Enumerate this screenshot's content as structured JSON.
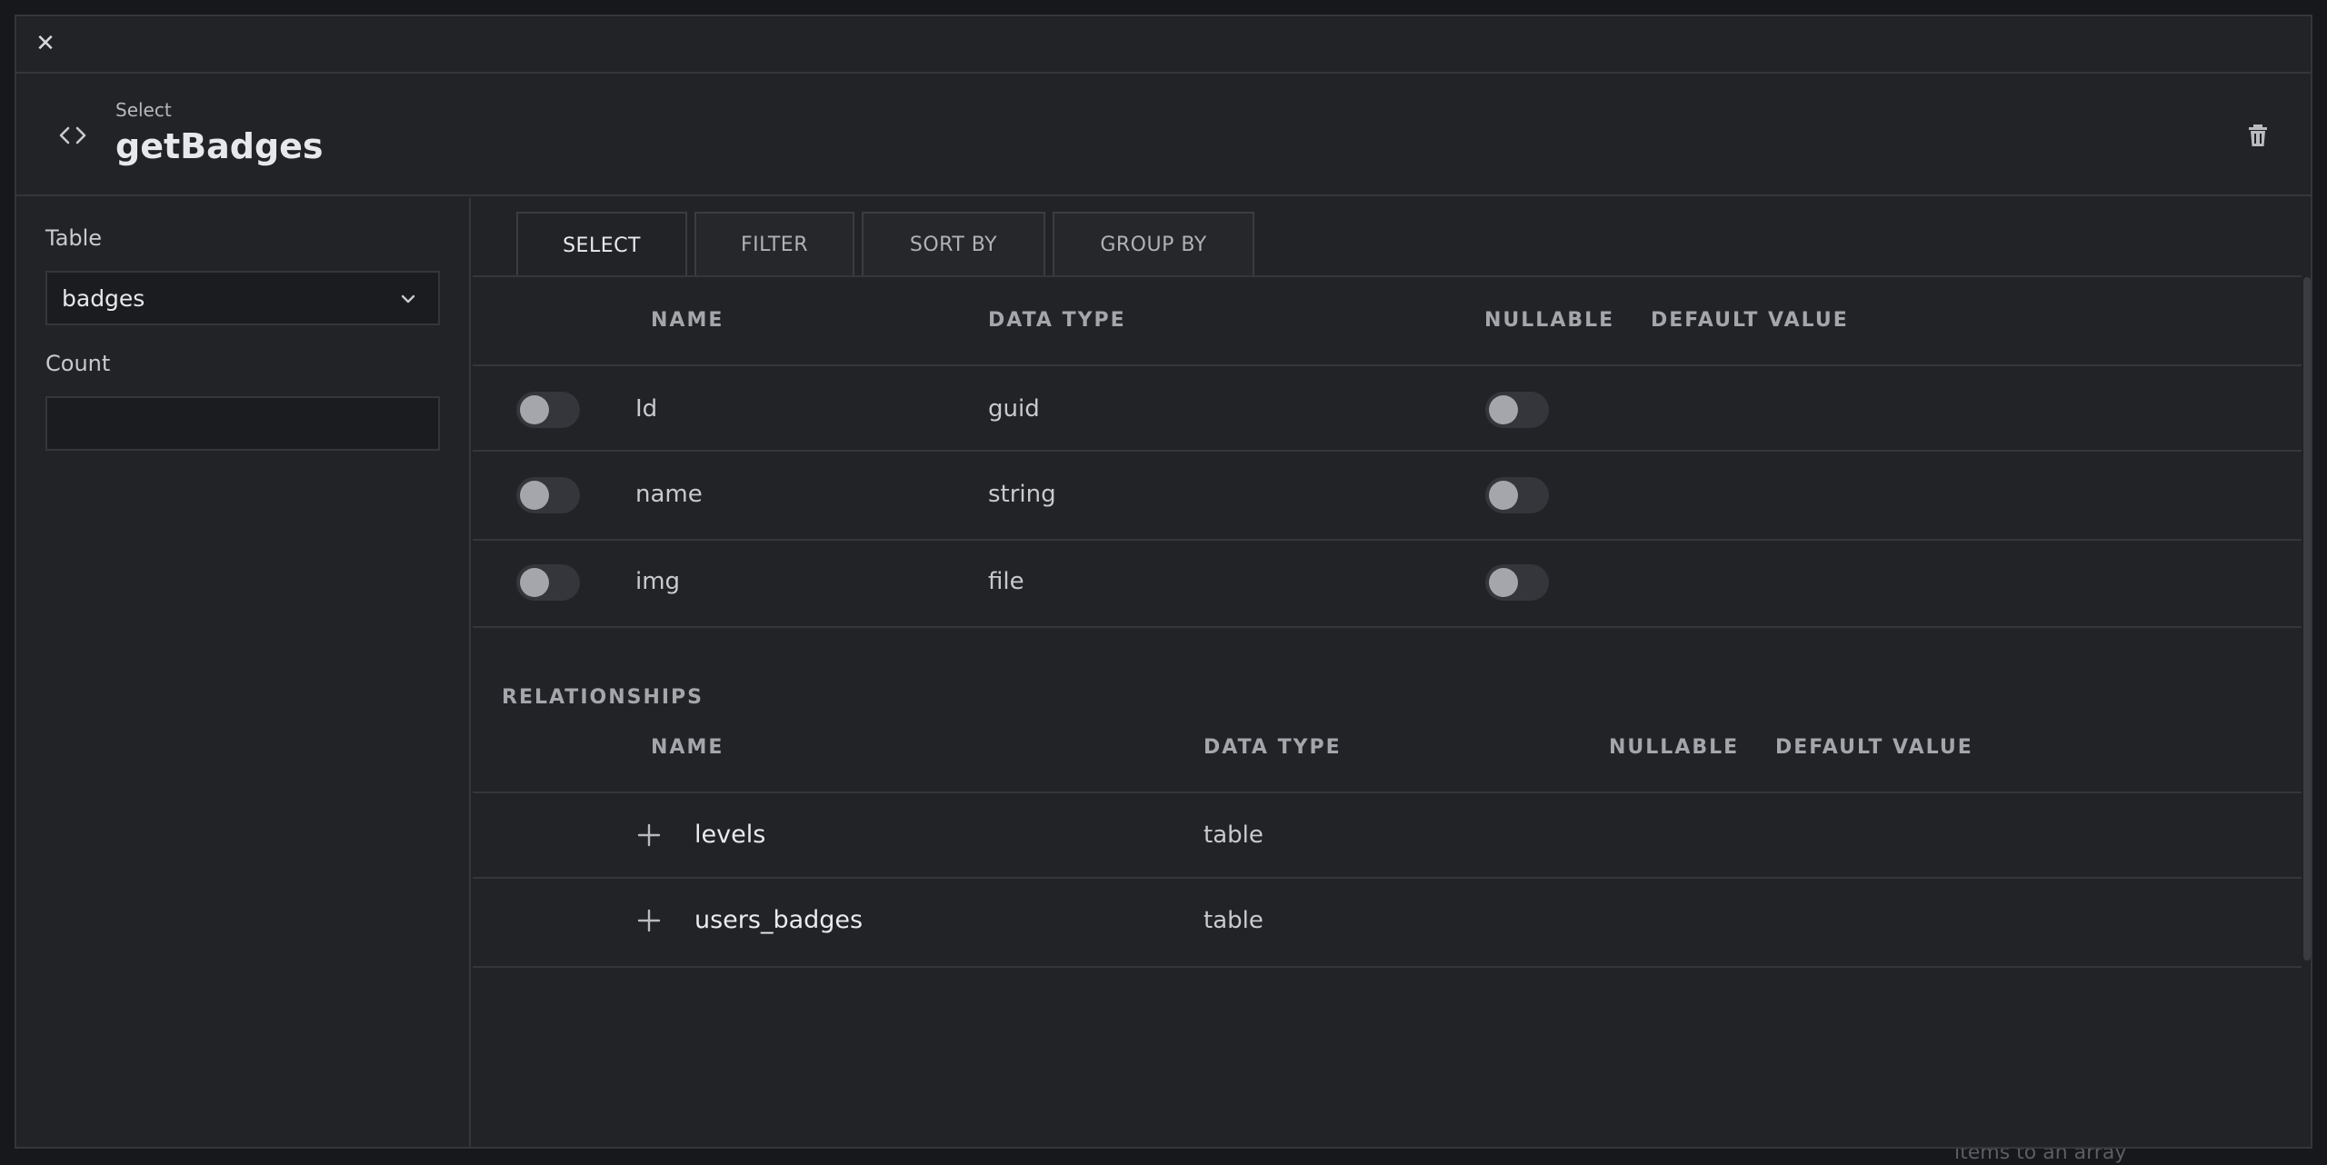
{
  "modal": {
    "close_glyph": "✕",
    "header": {
      "icon": "code-icon",
      "subtitle": "Select",
      "title": "getBadges",
      "delete_icon": "trash-icon"
    },
    "sidebar": {
      "table_label": "Table",
      "table_value": "badges",
      "count_label": "Count",
      "count_value": ""
    },
    "tabs": [
      {
        "label": "SELECT",
        "active": true
      },
      {
        "label": "FILTER",
        "active": false
      },
      {
        "label": "SORT BY",
        "active": false
      },
      {
        "label": "GROUP BY",
        "active": false
      }
    ],
    "fields": {
      "columns": [
        "NAME",
        "DATA TYPE",
        "NULLABLE",
        "DEFAULT VALUE"
      ],
      "rows": [
        {
          "name": "Id",
          "type": "guid",
          "selected": false,
          "nullable": false
        },
        {
          "name": "name",
          "type": "string",
          "selected": false,
          "nullable": false
        },
        {
          "name": "img",
          "type": "file",
          "selected": false,
          "nullable": false
        }
      ]
    },
    "relationships": {
      "title": "RELATIONSHIPS",
      "columns": [
        "NAME",
        "DATA TYPE",
        "NULLABLE",
        "DEFAULT VALUE"
      ],
      "rows": [
        {
          "name": "levels",
          "type": "table"
        },
        {
          "name": "users_badges",
          "type": "table"
        }
      ]
    }
  },
  "backdrop_text": "items to an array"
}
